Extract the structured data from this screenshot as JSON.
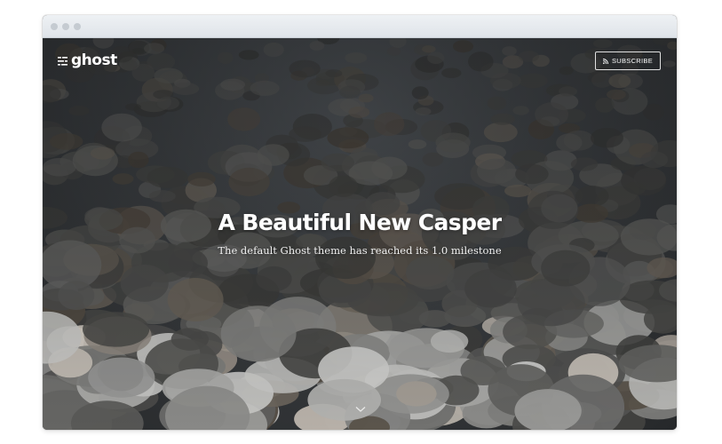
{
  "window": {
    "controls": [
      "close",
      "minimize",
      "maximize"
    ]
  },
  "site": {
    "logo_text": "ghost",
    "logo_icon": "ghost-lines-icon"
  },
  "nav": {
    "subscribe_label": "SUBSCRIBE",
    "subscribe_icon": "rss-icon"
  },
  "hero": {
    "title": "A Beautiful New Casper",
    "description": "The default Ghost theme has reached its 1.0 milestone",
    "scroll_icon": "chevron-down-icon",
    "background": "river-rocks-photo"
  },
  "colors": {
    "text": "#ffffff",
    "hero_dark": "#2a2c2e"
  }
}
